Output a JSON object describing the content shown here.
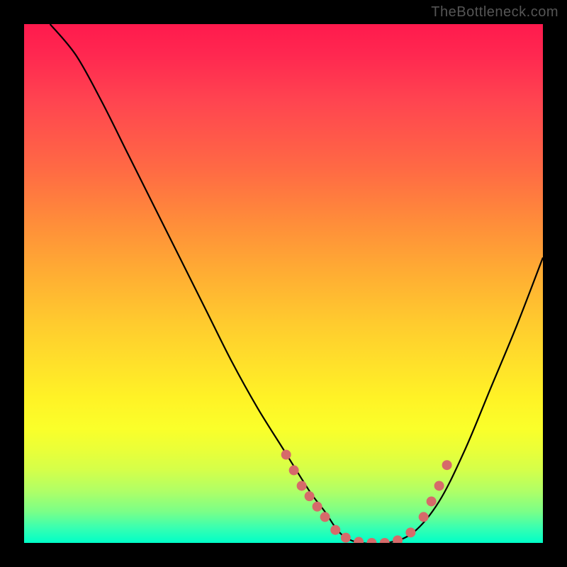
{
  "watermark": "TheBottleneck.com",
  "chart_data": {
    "type": "line",
    "title": "",
    "xlabel": "",
    "ylabel": "",
    "xlim": [
      0,
      100
    ],
    "ylim": [
      0,
      100
    ],
    "gradient_axis": "y",
    "gradient_stops": [
      {
        "pos": 0,
        "color": "#ff1a4d"
      },
      {
        "pos": 50,
        "color": "#ffcc2e"
      },
      {
        "pos": 80,
        "color": "#faff2a"
      },
      {
        "pos": 100,
        "color": "#00ffc8"
      }
    ],
    "series": [
      {
        "name": "bottleneck-curve",
        "x": [
          5,
          10,
          15,
          20,
          25,
          30,
          35,
          40,
          45,
          50,
          55,
          58,
          60,
          62,
          65,
          70,
          75,
          80,
          85,
          90,
          95,
          100
        ],
        "y": [
          100,
          94,
          85,
          75,
          65,
          55,
          45,
          35,
          26,
          18,
          10,
          6,
          3,
          1,
          0,
          0,
          2,
          8,
          18,
          30,
          42,
          55
        ]
      }
    ],
    "markers": [
      {
        "x": 50.5,
        "y": 17
      },
      {
        "x": 52.0,
        "y": 14
      },
      {
        "x": 53.5,
        "y": 11
      },
      {
        "x": 55.0,
        "y": 9
      },
      {
        "x": 56.5,
        "y": 7
      },
      {
        "x": 58.0,
        "y": 5
      },
      {
        "x": 60.0,
        "y": 2.5
      },
      {
        "x": 62.0,
        "y": 1
      },
      {
        "x": 64.5,
        "y": 0.2
      },
      {
        "x": 67.0,
        "y": 0
      },
      {
        "x": 69.5,
        "y": 0
      },
      {
        "x": 72.0,
        "y": 0.5
      },
      {
        "x": 74.5,
        "y": 2
      },
      {
        "x": 77.0,
        "y": 5
      },
      {
        "x": 78.5,
        "y": 8
      },
      {
        "x": 80.0,
        "y": 11
      },
      {
        "x": 81.5,
        "y": 15
      }
    ],
    "marker_color": "#d66a6a",
    "marker_radius": 7
  }
}
